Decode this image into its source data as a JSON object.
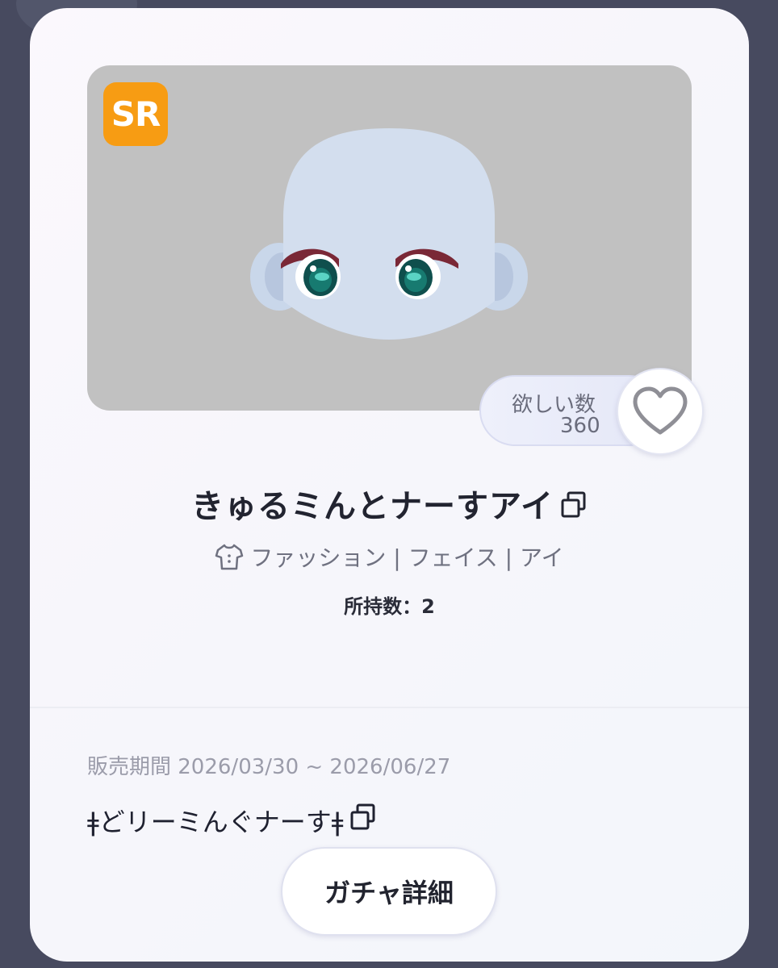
{
  "item": {
    "rarity": "SR",
    "title": "きゅるミんとナーすアイ",
    "categories": "ファッション | フェイス | アイ",
    "owned": "所持数：2"
  },
  "wishlist": {
    "label": "欲しい数",
    "count": "360"
  },
  "sale": {
    "period": "販売期間 2026/03/30 ~ 2026/06/27",
    "gacha_name": "ǂどリーミんぐナーすǂ",
    "details_button": "ガチャ詳細"
  },
  "colors": {
    "rarity_badge": "#f79c13",
    "image_bg": "#c1c1c1",
    "page_bg": "#474a5f"
  }
}
